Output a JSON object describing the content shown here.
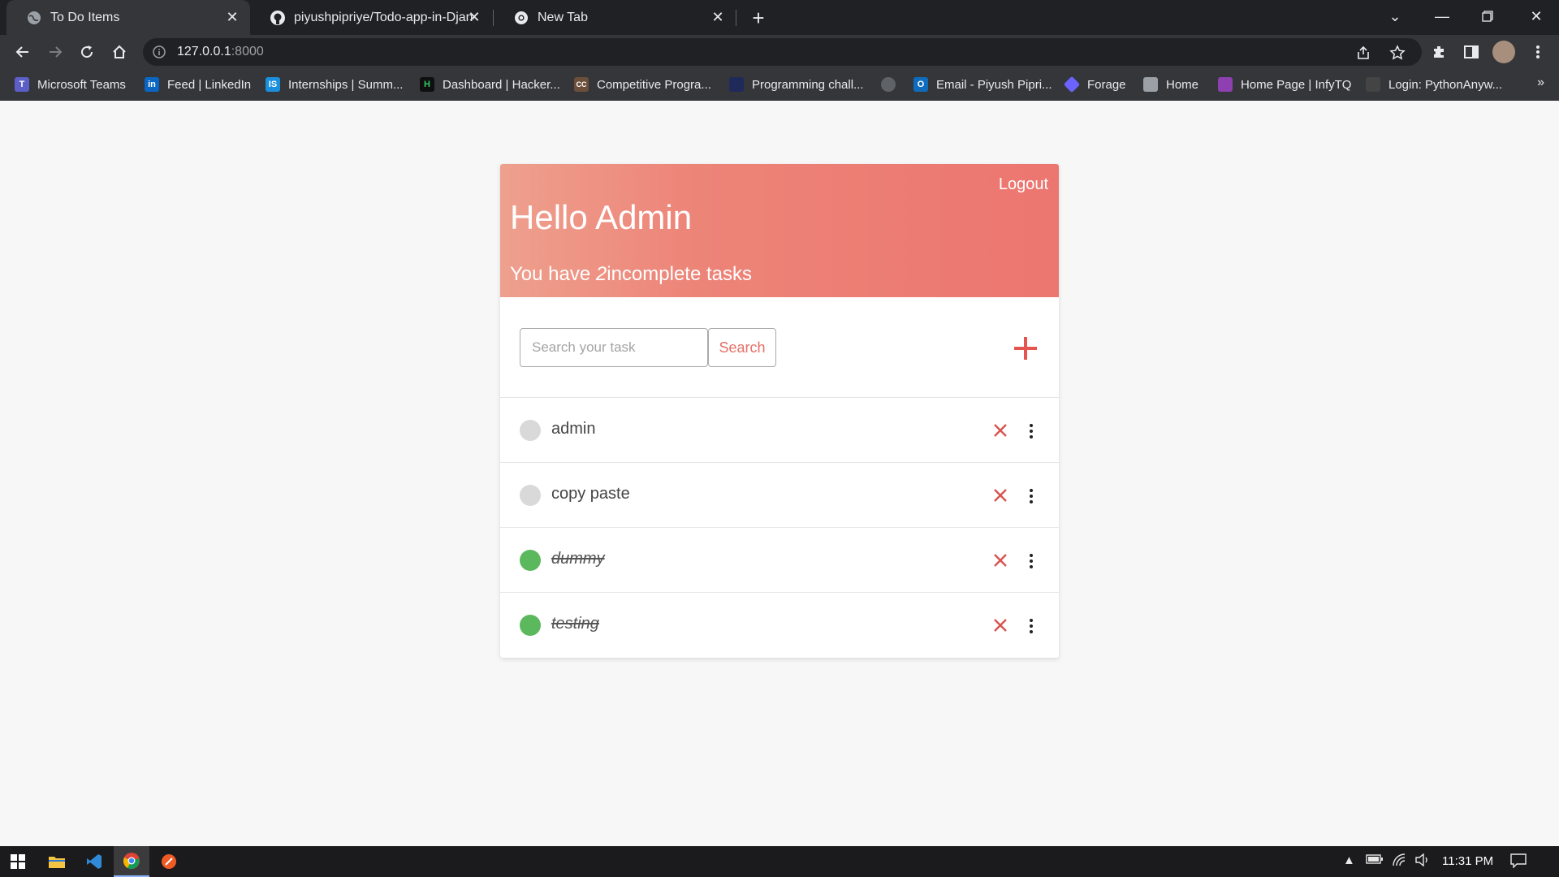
{
  "browser": {
    "tabs": [
      {
        "title": "To Do Items",
        "active": true,
        "icon": "globe-icon"
      },
      {
        "title": "piyushpipriye/Todo-app-in-Djang",
        "active": false,
        "icon": "github-icon"
      },
      {
        "title": "New Tab",
        "active": false,
        "icon": "chrome-icon"
      }
    ],
    "address": {
      "host": "127.0.0.1",
      "port": ":8000"
    },
    "bookmarks": [
      {
        "label": "Microsoft Teams",
        "icon": "teams-icon",
        "color": "#5b5fc7",
        "glyph": "T"
      },
      {
        "label": "Feed | LinkedIn",
        "icon": "linkedin-icon",
        "color": "#0a66c2",
        "glyph": "in"
      },
      {
        "label": "Internships | Summ...",
        "icon": "internshala-icon",
        "color": "#1a8fdd",
        "glyph": "IS"
      },
      {
        "label": "Dashboard | Hacker...",
        "icon": "hackerrank-icon",
        "color": "#0f0f0f",
        "glyph": "H"
      },
      {
        "label": "Competitive Progra...",
        "icon": "codechef-icon",
        "color": "#6b4f3a",
        "glyph": "CC"
      },
      {
        "label": "Programming chall...",
        "icon": "codeforces-icon",
        "color": "#1f2a5a",
        "glyph": ""
      },
      {
        "label": "",
        "icon": "globe-icon",
        "color": "#5f6368",
        "glyph": ""
      },
      {
        "label": "Email - Piyush Pipri...",
        "icon": "outlook-icon",
        "color": "#0f6cbd",
        "glyph": "O"
      },
      {
        "label": "Forage",
        "icon": "forage-icon",
        "color": "#6c63ff",
        "glyph": ""
      },
      {
        "label": "Home",
        "icon": "page-icon",
        "color": "#9aa0a6",
        "glyph": ""
      },
      {
        "label": "Home Page | InfyTQ",
        "icon": "infytq-icon",
        "color": "#8e3fb0",
        "glyph": ""
      },
      {
        "label": "Login: PythonAnyw...",
        "icon": "pythonanywhere-icon",
        "color": "#444",
        "glyph": ""
      }
    ],
    "more_label": "»"
  },
  "app": {
    "logout_label": "Logout",
    "greeting": "Hello Admin",
    "subtitle_prefix": "You have",
    "incomplete_count": "2",
    "subtitle_suffix": "incomplete tasks",
    "search_placeholder": "Search your task",
    "search_value": "",
    "search_button": "Search",
    "colors": {
      "accent": "#ec7670",
      "done": "#5cb85c",
      "pending": "#d9d9d9",
      "delete": "#d9534f"
    },
    "tasks": [
      {
        "title": "admin",
        "complete": false
      },
      {
        "title": "copy paste",
        "complete": false
      },
      {
        "title": "dummy",
        "complete": true
      },
      {
        "title": "testing",
        "complete": true
      }
    ]
  },
  "taskbar": {
    "apps": [
      "windows-start-icon",
      "file-explorer-icon",
      "vscode-icon",
      "chrome-icon",
      "postman-icon"
    ],
    "time": "11:31 PM"
  }
}
